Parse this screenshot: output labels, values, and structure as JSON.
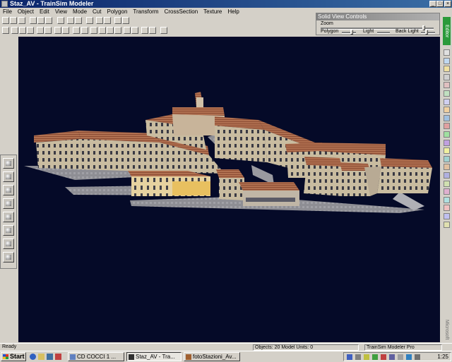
{
  "window": {
    "title": "Staz_AV - TrainSim Modeler"
  },
  "menu": [
    "File",
    "Object",
    "Edit",
    "View",
    "Mode",
    "Cut",
    "Polygon",
    "Transform",
    "CrossSection",
    "Texture",
    "Help"
  ],
  "solid_view_controls": {
    "title": "Solid View Controls",
    "zoom_label": "Zoom",
    "zoom_value": 0.92,
    "polygon_label": "Polygon",
    "light_label": "Light",
    "back_light_label": "Back Light",
    "polygon_value": 0.75,
    "back_light_value": 0.4
  },
  "right_tab_label": "Editor",
  "side_brand_label": "Microsoft",
  "status": {
    "left": "Ready",
    "objects": "Objects: 20 Model Units: 0",
    "product": "TrainSim Modeler Pro"
  },
  "taskbar": {
    "start_label": "Start",
    "tasks": [
      "CD COCCI 1 ...",
      "Staz_AV - Tra...",
      "fotoStazioni_Av..."
    ],
    "clock": "1:25"
  },
  "colors": {
    "titlebar": "#0a246a",
    "viewport_bg": "#050a28",
    "editor_tab": "#2a9a3a"
  }
}
